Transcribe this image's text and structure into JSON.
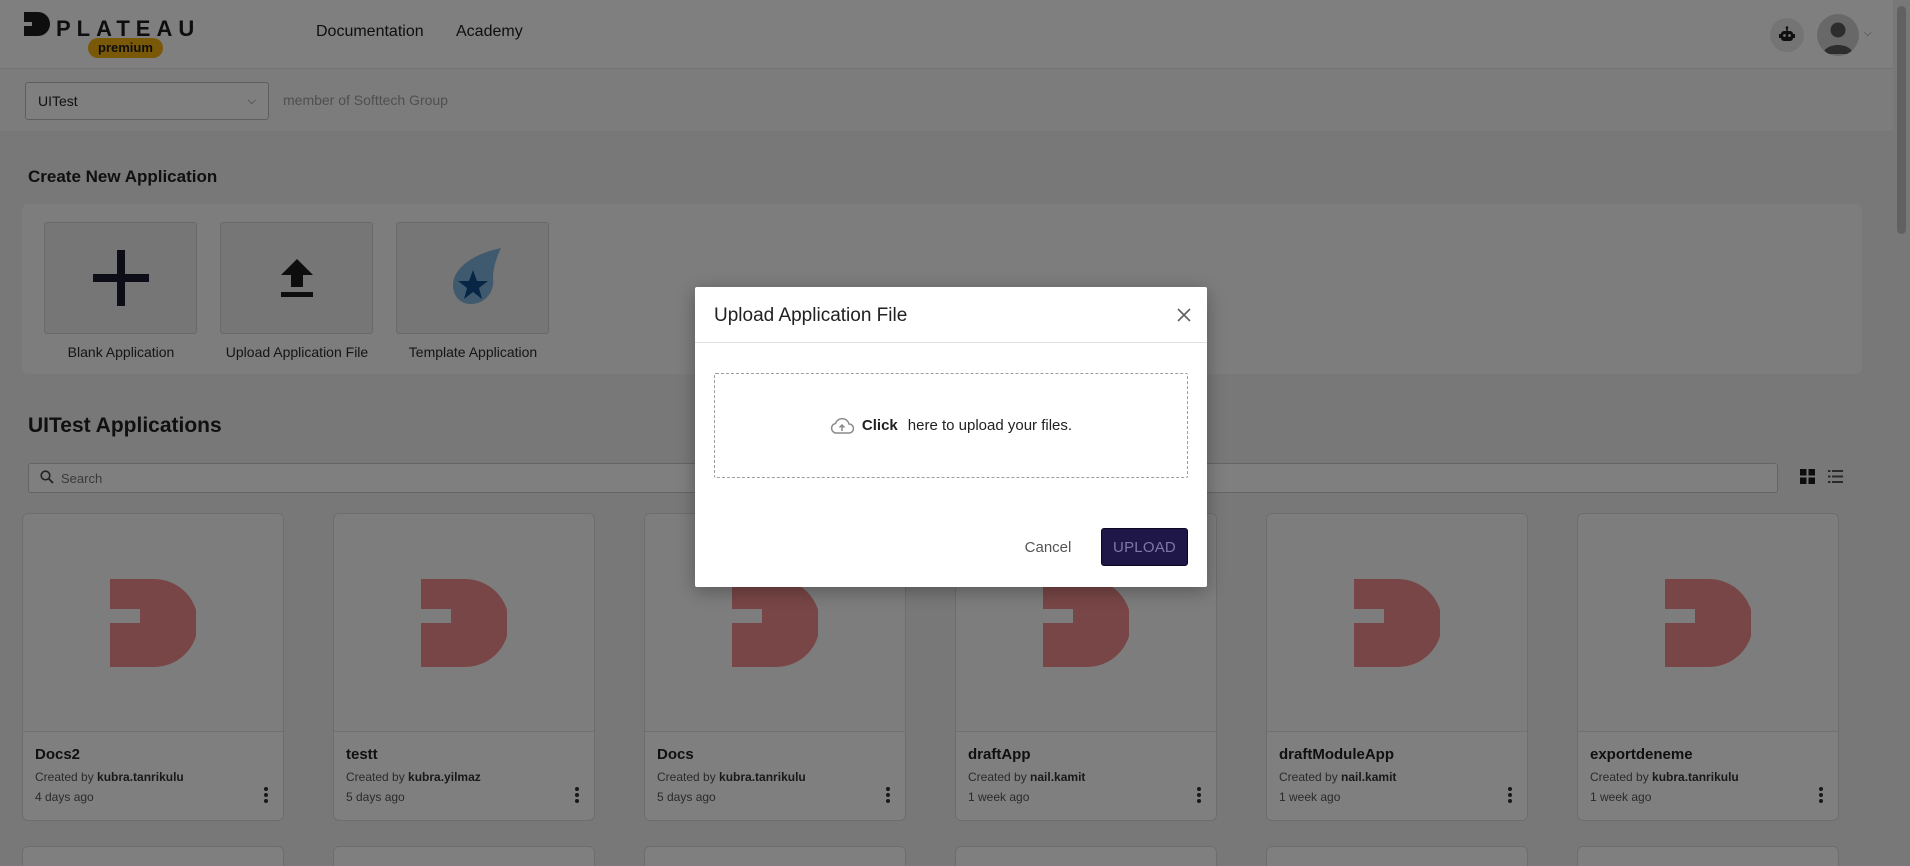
{
  "header": {
    "logo_text": "PLATEAU",
    "logo_badge": "premium",
    "nav": [
      "Documentation",
      "Academy"
    ]
  },
  "subheader": {
    "org_select_value": "UITest",
    "member_text": "member of Softtech Group"
  },
  "create": {
    "title": "Create New Application",
    "tiles": [
      {
        "label": "Blank Application",
        "icon": "plus-icon"
      },
      {
        "label": "Upload Application File",
        "icon": "upload-icon"
      },
      {
        "label": "Template Application",
        "icon": "rocket-star-icon"
      }
    ]
  },
  "applications": {
    "title": "UITest Applications",
    "search_placeholder": "Search",
    "created_by_prefix": "Created by",
    "items": [
      {
        "name": "Docs2",
        "creator": "kubra.tanrikulu",
        "time": "4 days ago"
      },
      {
        "name": "testt",
        "creator": "kubra.yilmaz",
        "time": "5 days ago"
      },
      {
        "name": "Docs",
        "creator": "kubra.tanrikulu",
        "time": "5 days ago"
      },
      {
        "name": "draftApp",
        "creator": "nail.kamit",
        "time": "1 week ago"
      },
      {
        "name": "draftModuleApp",
        "creator": "nail.kamit",
        "time": "1 week ago"
      },
      {
        "name": "exportdeneme",
        "creator": "kubra.tanrikulu",
        "time": "1 week ago"
      }
    ]
  },
  "modal": {
    "title": "Upload Application File",
    "dropzone_click": "Click",
    "dropzone_text": "here to upload your files.",
    "cancel_label": "Cancel",
    "upload_label": "UPLOAD"
  },
  "colors": {
    "brand_badge": "#f2b10f",
    "primary_button": "#1f1747",
    "thumb_logo": "#f08d8d"
  }
}
